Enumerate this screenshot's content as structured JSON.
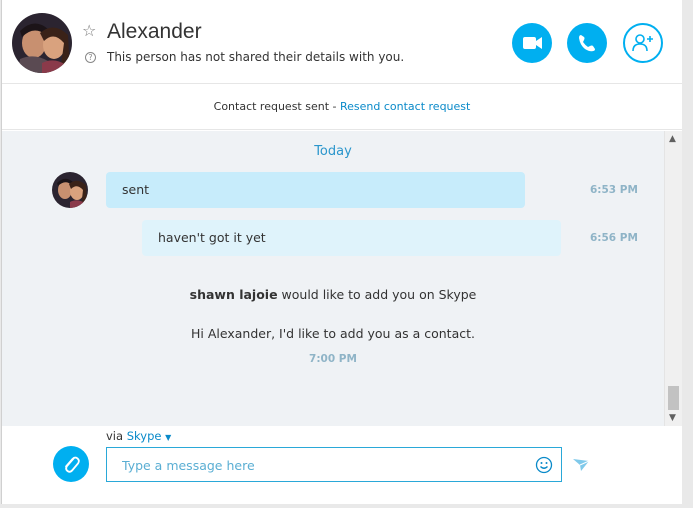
{
  "header": {
    "contact_name": "Alexander",
    "status_text": "This person has not shared their details with you.",
    "video_call_icon": "video-camera-icon",
    "audio_call_icon": "phone-icon",
    "add_people_icon": "add-person-icon",
    "accent_color": "#00aff0"
  },
  "request_bar": {
    "text": "Contact request sent - ",
    "link": "Resend contact request"
  },
  "chat": {
    "day_label": "Today",
    "messages": [
      {
        "text": "sent",
        "time": "6:53 PM"
      },
      {
        "text": "haven't got it yet",
        "time": "6:56 PM"
      }
    ],
    "system": {
      "sender": "shawn lajoie",
      "action": " would like to add you on Skype",
      "body": "Hi Alexander, I'd like to add you as a contact.",
      "time": "7:00 PM"
    }
  },
  "composer": {
    "via_prefix": "via ",
    "service": "Skype",
    "placeholder": "Type a message here",
    "value": ""
  }
}
